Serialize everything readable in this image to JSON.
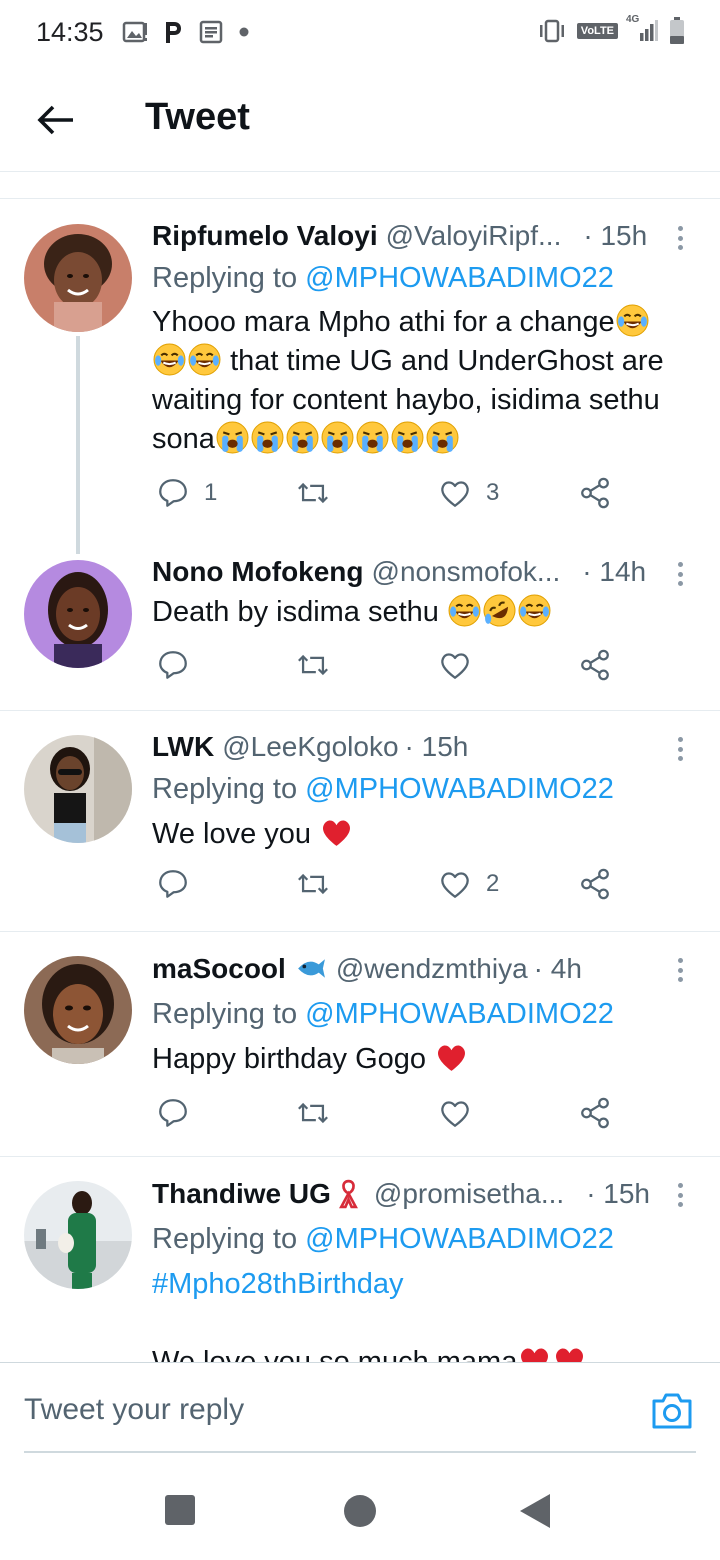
{
  "status_bar": {
    "time": "14:35",
    "network": "4G",
    "volte": "VoLTE"
  },
  "header": {
    "title": "Tweet"
  },
  "tweets": [
    {
      "name": "Ripfumelo Valoyi",
      "handle": "@ValoyiRipf...",
      "time": "· 15h",
      "replying_prefix": "Replying to",
      "replying_to": "@MPHOWABADIMO22",
      "text_1": "Yhooo mara Mpho athi for a change",
      "text_2": "that time UG and UnderGhost are waiting for content haybo, isidima sethu sona",
      "reply_count": "1",
      "like_count": "3"
    },
    {
      "name": "Nono Mofokeng",
      "handle": "@nonsmofok...",
      "time": "· 14h",
      "text": "Death by isdima sethu"
    },
    {
      "name": "LWK",
      "handle": "@LeeKgoloko",
      "time": "· 15h",
      "replying_prefix": "Replying to",
      "replying_to": "@MPHOWABADIMO22",
      "text": "We love you",
      "like_count": "2"
    },
    {
      "name": "maSocool",
      "handle": "@wendzmthiya",
      "time": "· 4h",
      "replying_prefix": "Replying to",
      "replying_to": "@MPHOWABADIMO22",
      "text": "Happy birthday Gogo"
    },
    {
      "name": "Thandiwe UG",
      "handle": "@promisetha...",
      "time": "· 15h",
      "replying_prefix": "Replying to",
      "replying_to": "@MPHOWABADIMO22",
      "hashtag": "#Mpho28thBirthday",
      "text_partial": "We love you so much mama"
    }
  ],
  "reply_box": {
    "placeholder": "Tweet your reply"
  },
  "colors": {
    "link": "#1d9bf0",
    "secondary_text": "#536471",
    "divider": "#e6ecf0",
    "heart": "#e0245e"
  },
  "icons": [
    "back-arrow-icon",
    "reply-icon",
    "retweet-icon",
    "like-icon",
    "share-icon",
    "more-icon",
    "camera-icon"
  ]
}
